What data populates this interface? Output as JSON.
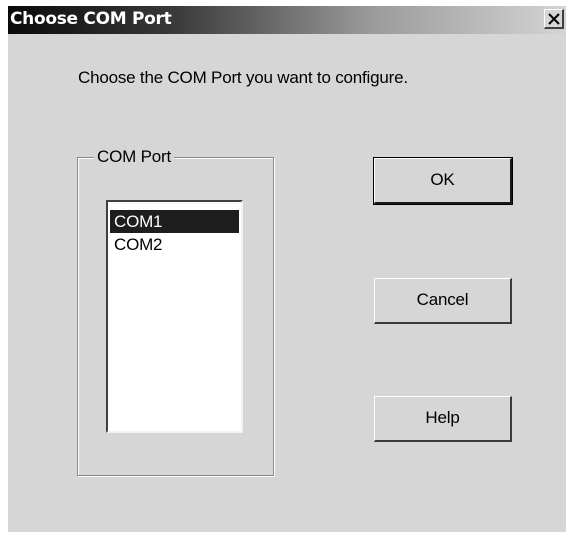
{
  "window": {
    "title": "Choose COM Port",
    "close_symbol": "close-icon"
  },
  "instruction": "Choose the COM Port you want to configure.",
  "group": {
    "label": "COM Port",
    "items": [
      {
        "label": "COM1",
        "selected": true
      },
      {
        "label": "COM2",
        "selected": false
      }
    ]
  },
  "buttons": {
    "ok": "OK",
    "cancel": "Cancel",
    "help": "Help"
  }
}
